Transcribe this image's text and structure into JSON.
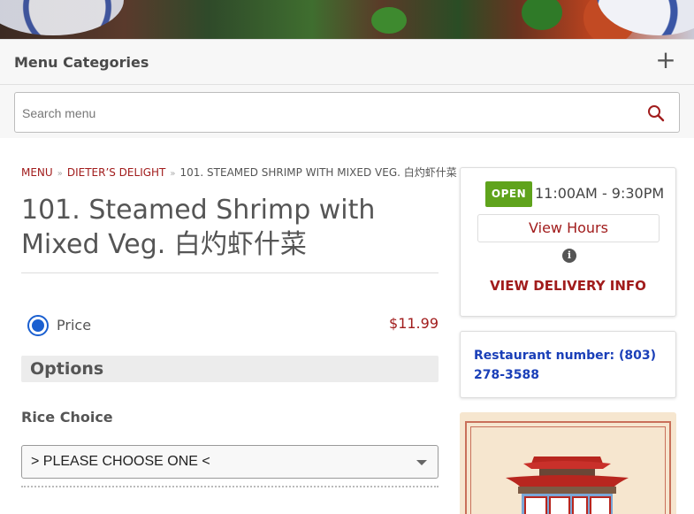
{
  "categories": {
    "title": "Menu Categories",
    "toggle_symbol": "+"
  },
  "search": {
    "placeholder": "Search menu",
    "icon": "search-icon"
  },
  "breadcrumb": {
    "menu": "MENU",
    "category": "DIETER’S DELIGHT",
    "current": "101. STEAMED SHRIMP WITH MIXED VEG. 白灼虾什菜"
  },
  "item": {
    "title": "101. Steamed Shrimp with Mixed Veg. 白灼虾什菜",
    "price_label": "Price",
    "price_value": "$11.99",
    "price_selected": true
  },
  "options": {
    "heading": "Options",
    "rice_label": "Rice Choice",
    "rice_selected": "> PLEASE CHOOSE ONE <"
  },
  "hours": {
    "status": "OPEN",
    "time": "11:00AM - 9:30PM",
    "view_hours": "View Hours",
    "delivery_info": "VIEW DELIVERY INFO"
  },
  "phone": {
    "text": "Restaurant number: (803) 278-3588"
  },
  "colors": {
    "brand_red": "#a11c1c",
    "open_green": "#5fa31c",
    "phone_blue": "#1a3fb8",
    "radio_blue": "#1a5fd0"
  }
}
